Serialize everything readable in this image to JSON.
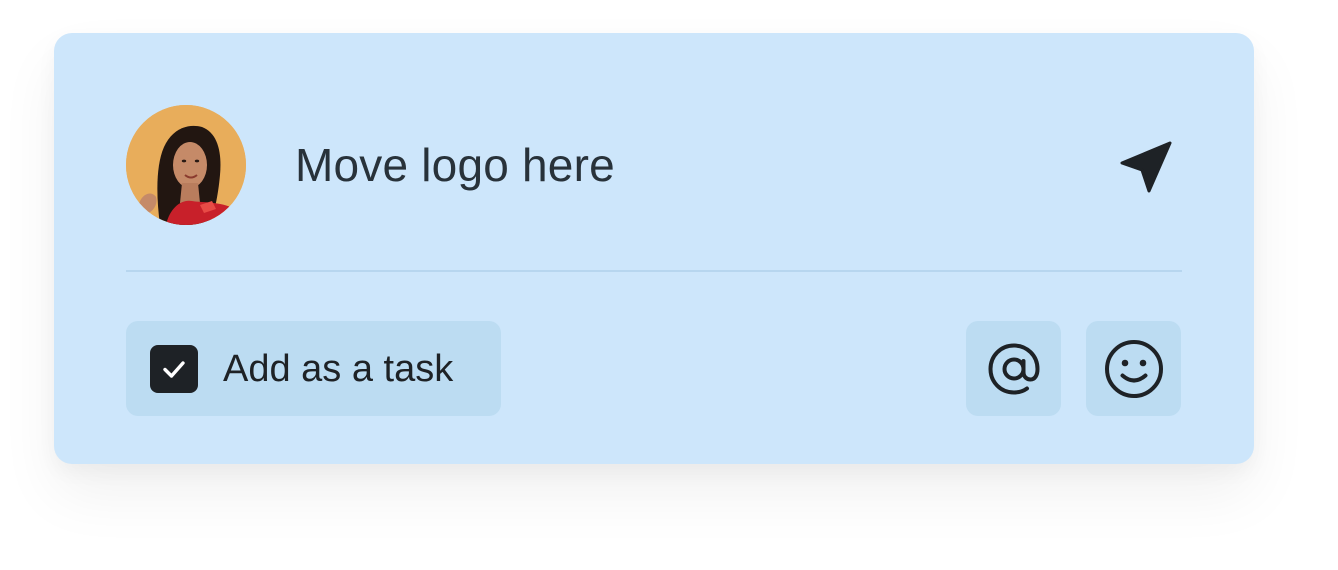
{
  "composer": {
    "message": "Move logo here",
    "avatar_icon": "user-avatar-photo",
    "send_icon": "send-icon",
    "task_toggle": {
      "label": "Add as a task",
      "checked": true,
      "icon": "checkbox-checked-icon"
    },
    "actions": [
      {
        "name": "mention",
        "icon": "at-sign-icon"
      },
      {
        "name": "emoji",
        "icon": "smiley-icon"
      }
    ],
    "colors": {
      "card_background": "#cde6fb",
      "button_background": "#bcdcf2",
      "divider": "#b7d6ef",
      "text": "#28323a",
      "icon": "#1e2226",
      "avatar_background": "#e8ad5b"
    }
  }
}
